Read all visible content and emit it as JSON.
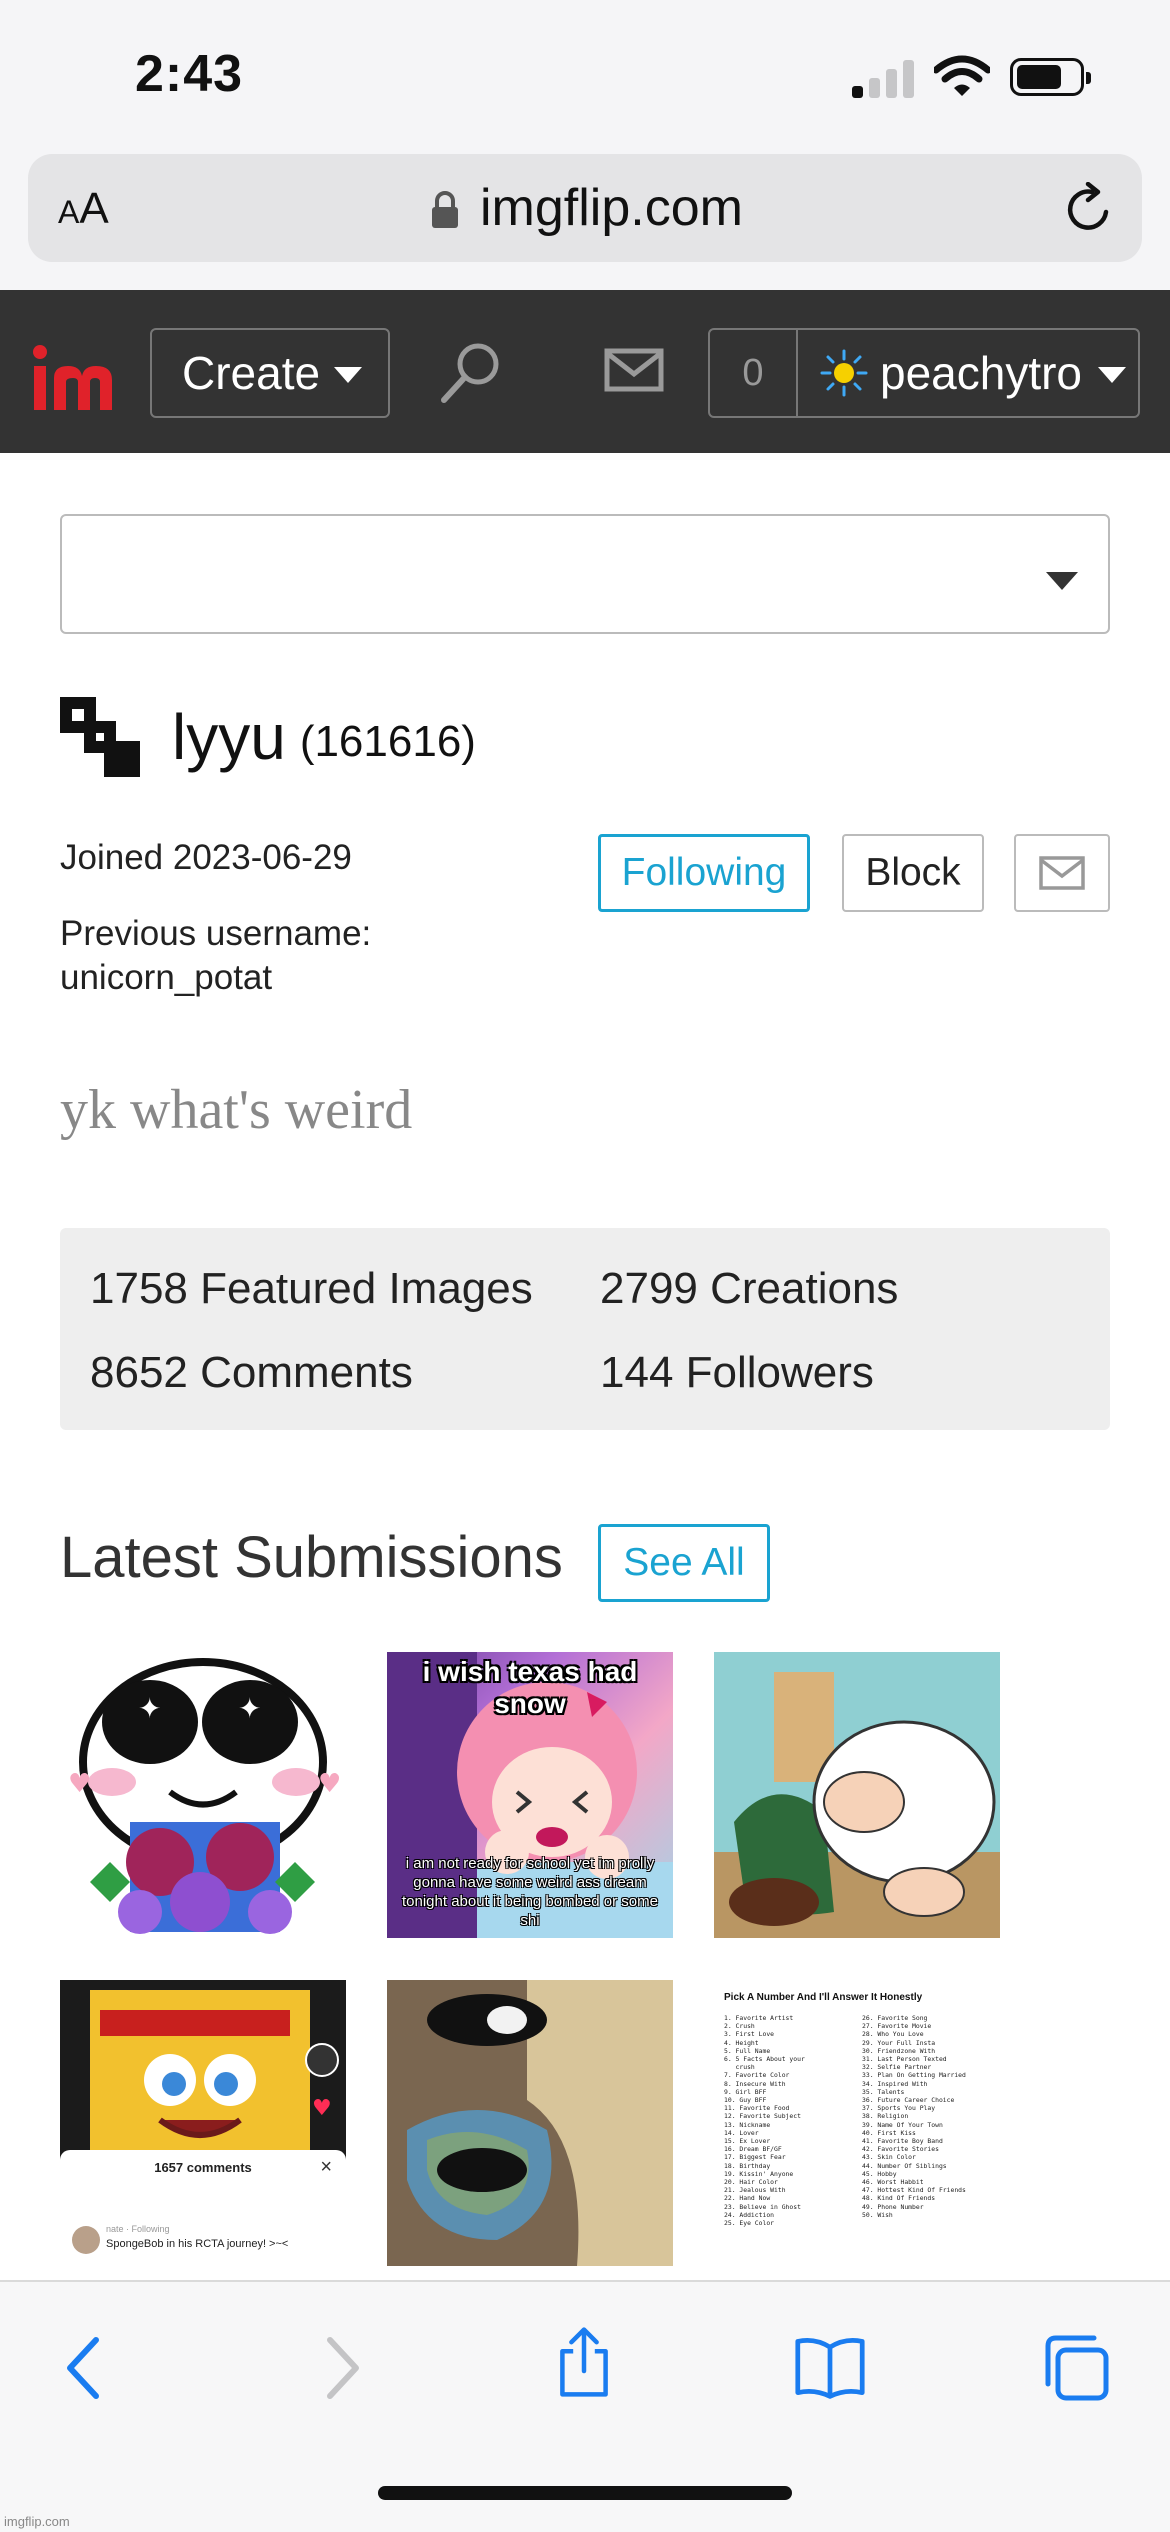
{
  "status_bar": {
    "time": "2:43"
  },
  "browser": {
    "aa_small": "A",
    "aa_large": "A",
    "url": "imgflip.com"
  },
  "site_header": {
    "create_label": "Create",
    "notification_count": "0",
    "username": "peachytro"
  },
  "profile": {
    "select_value": "",
    "name": "lyyu",
    "points": "(161616)",
    "joined": "Joined 2023-06-29",
    "previous_username_label": "Previous username:",
    "previous_username": "unicorn_potat",
    "following_label": "Following",
    "block_label": "Block",
    "bio": "yk what's weird"
  },
  "stats": {
    "featured": "1758 Featured Images",
    "creations": "2799 Creations",
    "comments": "8652 Comments",
    "followers": "144 Followers"
  },
  "submissions": {
    "title": "Latest Submissions",
    "see_all_label": "See All",
    "items": [
      {
        "top_text": "",
        "bottom_text": ""
      },
      {
        "top_text": "i wish texas had snow",
        "bottom_text": "i am not ready for school yet im prolly gonna have some weird ass dream tonight about it being bombed or some shi"
      },
      {
        "top_text": "",
        "bottom_text": ""
      },
      {
        "comments_count": "1657 comments",
        "comment_user": "nate · Following",
        "comment_text": "SpongeBob in his RCTA journey! >~<"
      },
      {
        "top_text": "",
        "bottom_text": ""
      },
      {
        "list_title": "Pick A Number And I'll Answer It Honestly"
      }
    ]
  },
  "watermark": "imgflip.com",
  "colors": {
    "header_bg": "#333333",
    "accent_blue": "#1aa3d1",
    "logo_red": "#e0222a",
    "stats_bg": "#eeeeee",
    "ios_blue": "#1a7cf0"
  },
  "icons": {
    "search": "search-icon",
    "mail": "mail-icon",
    "back": "chevron-left-icon",
    "forward": "chevron-right-icon",
    "share": "share-icon",
    "bookmarks": "book-icon",
    "tabs": "tabs-icon"
  }
}
